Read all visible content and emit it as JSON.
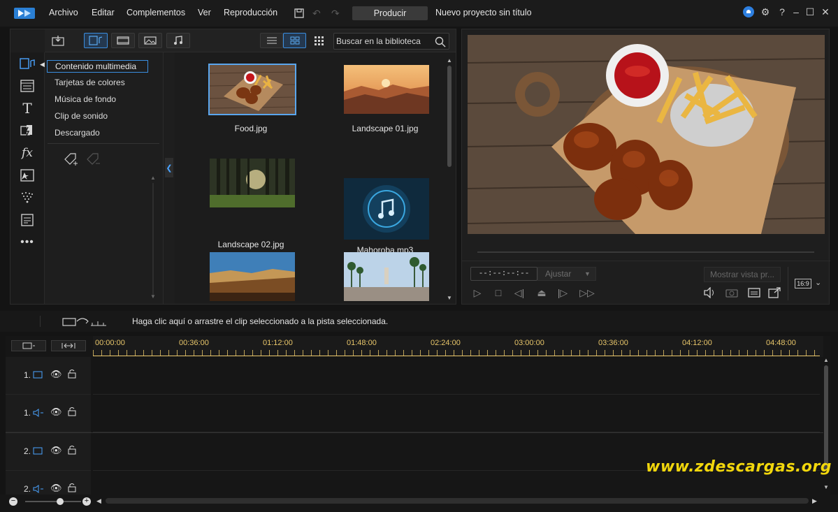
{
  "menu": {
    "archivo": "Archivo",
    "editar": "Editar",
    "complementos": "Complementos",
    "ver": "Ver",
    "reproduccion": "Reproducción",
    "producir": "Producir",
    "project_title": "Nuevo proyecto sin título"
  },
  "library": {
    "search_placeholder": "Buscar en la biblioteca",
    "categories": [
      "Contenido multimedia",
      "Tarjetas de colores",
      "Música de fondo",
      "Clip de sonido",
      "Descargado"
    ],
    "media": [
      {
        "name": "Food.jpg",
        "kind": "food"
      },
      {
        "name": "Landscape 01.jpg",
        "kind": "landscape01"
      },
      {
        "name": "Landscape 02.jpg",
        "kind": "landscape02"
      },
      {
        "name": "Mahoroba.mp3",
        "kind": "audio"
      },
      {
        "name": "",
        "kind": "landscape03"
      },
      {
        "name": "",
        "kind": "skate"
      }
    ]
  },
  "preview": {
    "timecode": "--:--:--:--",
    "adjust_label": "Ajustar",
    "show_label": "Mostrar vista pr...",
    "ratio": "16:9"
  },
  "timeline": {
    "hint": "Haga clic aquí o arrastre el clip seleccionado a la pista seleccionada.",
    "ticks": [
      "00:00:00",
      "00:36:00",
      "01:12:00",
      "01:48:00",
      "02:24:00",
      "03:00:00",
      "03:36:00",
      "04:12:00",
      "04:48:00"
    ],
    "tracks": [
      {
        "num": "1.",
        "type": "video"
      },
      {
        "num": "1.",
        "type": "audio"
      },
      {
        "num": "2.",
        "type": "video"
      },
      {
        "num": "2.",
        "type": "audio"
      }
    ]
  },
  "watermark": "www.zdescargas.org",
  "colors": {
    "accent": "#3a8ee0",
    "ruler_text": "#e8c66a",
    "watermark": "#f2d70c"
  }
}
